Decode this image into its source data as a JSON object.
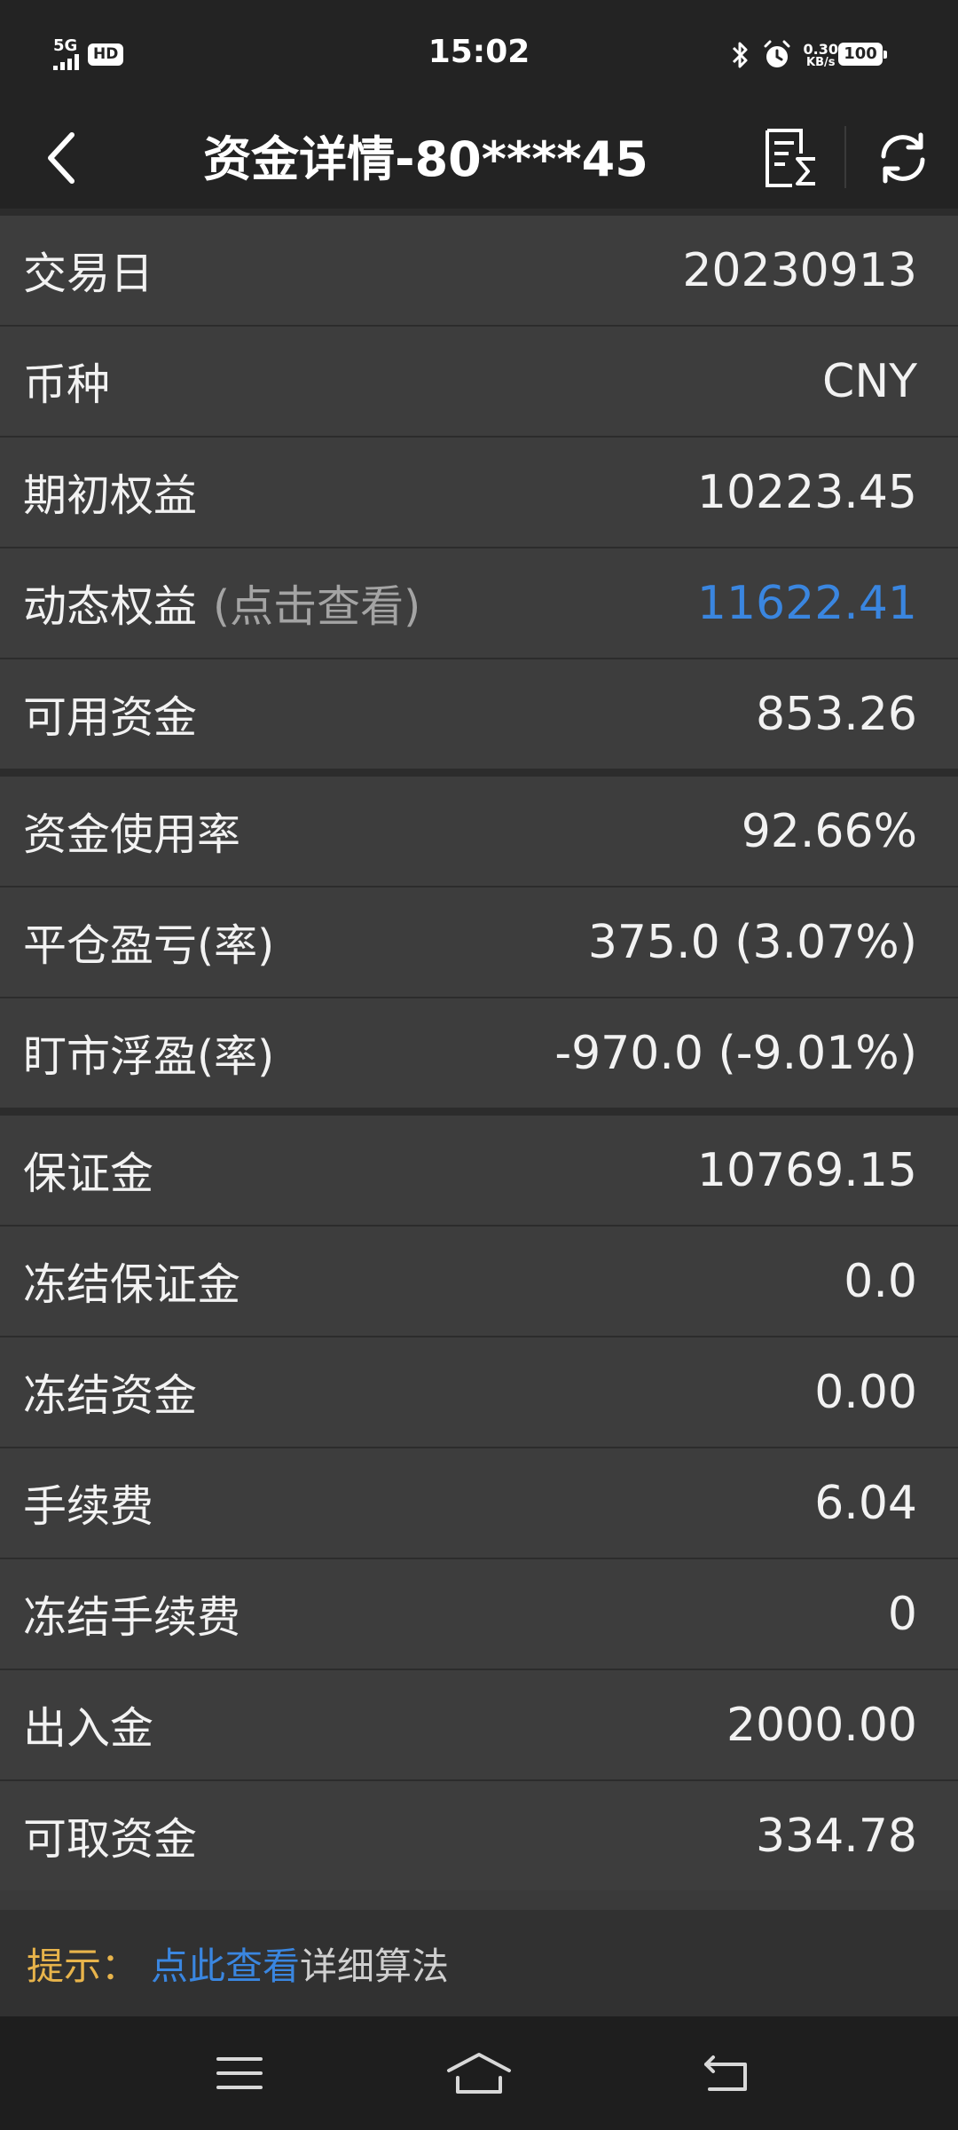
{
  "status_bar": {
    "network": "5G",
    "hd": "HD",
    "time": "15:02",
    "speed_value": "0.30",
    "speed_unit": "KB/s",
    "battery": "100"
  },
  "header": {
    "title": "资金详情-80****45"
  },
  "rows": [
    {
      "label": "交易日",
      "value": "20230913"
    },
    {
      "label": "币种",
      "value": "CNY"
    },
    {
      "label": "期初权益",
      "value": "10223.45"
    },
    {
      "label": "动态权益",
      "hint": "(点击查看)",
      "value": "11622.41"
    },
    {
      "label": "可用资金",
      "value": "853.26"
    },
    {
      "label": "资金使用率",
      "value": "92.66%"
    },
    {
      "label": "平仓盈亏(率)",
      "value": "375.0 (3.07%)"
    },
    {
      "label": "盯市浮盈(率)",
      "value": "-970.0 (-9.01%)"
    },
    {
      "label": "保证金",
      "value": "10769.15"
    },
    {
      "label": "冻结保证金",
      "value": "0.0"
    },
    {
      "label": "冻结资金",
      "value": "0.00"
    },
    {
      "label": "手续费",
      "value": "6.04"
    },
    {
      "label": "冻结手续费",
      "value": "0"
    },
    {
      "label": "出入金",
      "value": "2000.00"
    },
    {
      "label": "可取资金",
      "value": "334.78"
    }
  ],
  "tip": {
    "prefix": "提示：",
    "link": "点此查看",
    "rest": "详细算法"
  },
  "icons": {
    "back": "chevron-left-icon",
    "stats": "list-sum-icon",
    "refresh": "refresh-icon",
    "menu": "menu-icon",
    "home": "home-icon",
    "nav_back": "return-icon"
  },
  "colors": {
    "link": "#3a86e0",
    "tip_prefix": "#e8b44b",
    "header_bg": "#232323",
    "row_bg": "#3d3d3d"
  }
}
